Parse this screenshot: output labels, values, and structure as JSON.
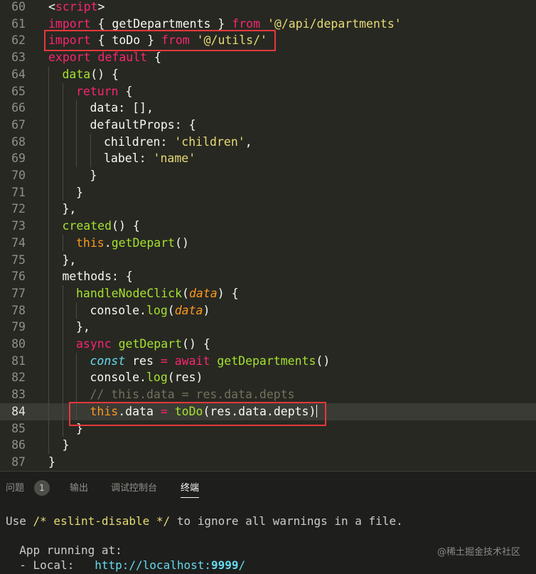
{
  "editor": {
    "lines": [
      {
        "num": "60",
        "indent": 0,
        "tokens": [
          {
            "c": "t-plain",
            "t": "<"
          },
          {
            "c": "t-tag",
            "t": "script"
          },
          {
            "c": "t-plain",
            "t": ">"
          }
        ]
      },
      {
        "num": "61",
        "indent": 0,
        "tokens": [
          {
            "c": "t-key",
            "t": "import"
          },
          {
            "c": "t-plain",
            "t": " { getDepartments } "
          },
          {
            "c": "t-key",
            "t": "from"
          },
          {
            "c": "t-plain",
            "t": " "
          },
          {
            "c": "t-str",
            "t": "'@/api/departments'"
          }
        ]
      },
      {
        "num": "62",
        "indent": 0,
        "tokens": [
          {
            "c": "t-key",
            "t": "import"
          },
          {
            "c": "t-plain",
            "t": " { toDo } "
          },
          {
            "c": "t-key",
            "t": "from"
          },
          {
            "c": "t-plain",
            "t": " "
          },
          {
            "c": "t-str",
            "t": "'@/utils/'"
          }
        ]
      },
      {
        "num": "63",
        "indent": 0,
        "tokens": [
          {
            "c": "t-key",
            "t": "export"
          },
          {
            "c": "t-plain",
            "t": " "
          },
          {
            "c": "t-key",
            "t": "default"
          },
          {
            "c": "t-plain",
            "t": " {"
          }
        ]
      },
      {
        "num": "64",
        "indent": 1,
        "tokens": [
          {
            "c": "t-fn",
            "t": "data"
          },
          {
            "c": "t-plain",
            "t": "() {"
          }
        ]
      },
      {
        "num": "65",
        "indent": 2,
        "tokens": [
          {
            "c": "t-key",
            "t": "return"
          },
          {
            "c": "t-plain",
            "t": " {"
          }
        ]
      },
      {
        "num": "66",
        "indent": 3,
        "tokens": [
          {
            "c": "t-plain",
            "t": "data: [],"
          }
        ]
      },
      {
        "num": "67",
        "indent": 3,
        "tokens": [
          {
            "c": "t-plain",
            "t": "defaultProps: {"
          }
        ]
      },
      {
        "num": "68",
        "indent": 4,
        "tokens": [
          {
            "c": "t-plain",
            "t": "children: "
          },
          {
            "c": "t-str",
            "t": "'children'"
          },
          {
            "c": "t-plain",
            "t": ","
          }
        ]
      },
      {
        "num": "69",
        "indent": 4,
        "tokens": [
          {
            "c": "t-plain",
            "t": "label: "
          },
          {
            "c": "t-str",
            "t": "'name'"
          }
        ]
      },
      {
        "num": "70",
        "indent": 3,
        "tokens": [
          {
            "c": "t-plain",
            "t": "}"
          }
        ]
      },
      {
        "num": "71",
        "indent": 2,
        "tokens": [
          {
            "c": "t-plain",
            "t": "}"
          }
        ]
      },
      {
        "num": "72",
        "indent": 1,
        "tokens": [
          {
            "c": "t-plain",
            "t": "},"
          }
        ]
      },
      {
        "num": "73",
        "indent": 1,
        "tokens": [
          {
            "c": "t-fn",
            "t": "created"
          },
          {
            "c": "t-plain",
            "t": "() {"
          }
        ]
      },
      {
        "num": "74",
        "indent": 2,
        "tokens": [
          {
            "c": "t-this",
            "t": "this"
          },
          {
            "c": "t-plain",
            "t": "."
          },
          {
            "c": "t-fn",
            "t": "getDepart"
          },
          {
            "c": "t-plain",
            "t": "()"
          }
        ]
      },
      {
        "num": "75",
        "indent": 1,
        "tokens": [
          {
            "c": "t-plain",
            "t": "},"
          }
        ]
      },
      {
        "num": "76",
        "indent": 1,
        "tokens": [
          {
            "c": "t-plain",
            "t": "methods: {"
          }
        ]
      },
      {
        "num": "77",
        "indent": 2,
        "tokens": [
          {
            "c": "t-fn",
            "t": "handleNodeClick"
          },
          {
            "c": "t-plain",
            "t": "("
          },
          {
            "c": "t-param",
            "t": "data"
          },
          {
            "c": "t-plain",
            "t": ") {"
          }
        ]
      },
      {
        "num": "78",
        "indent": 3,
        "tokens": [
          {
            "c": "t-plain",
            "t": "console."
          },
          {
            "c": "t-fn",
            "t": "log"
          },
          {
            "c": "t-plain",
            "t": "("
          },
          {
            "c": "t-param",
            "t": "data"
          },
          {
            "c": "t-plain",
            "t": ")"
          }
        ]
      },
      {
        "num": "79",
        "indent": 2,
        "tokens": [
          {
            "c": "t-plain",
            "t": "},"
          }
        ]
      },
      {
        "num": "80",
        "indent": 2,
        "tokens": [
          {
            "c": "t-key",
            "t": "async"
          },
          {
            "c": "t-plain",
            "t": " "
          },
          {
            "c": "t-fn",
            "t": "getDepart"
          },
          {
            "c": "t-plain",
            "t": "() {"
          }
        ]
      },
      {
        "num": "81",
        "indent": 3,
        "tokens": [
          {
            "c": "t-storage",
            "t": "const"
          },
          {
            "c": "t-plain",
            "t": " res "
          },
          {
            "c": "t-key",
            "t": "="
          },
          {
            "c": "t-plain",
            "t": " "
          },
          {
            "c": "t-key",
            "t": "await"
          },
          {
            "c": "t-plain",
            "t": " "
          },
          {
            "c": "t-fn",
            "t": "getDepartments"
          },
          {
            "c": "t-plain",
            "t": "()"
          }
        ]
      },
      {
        "num": "82",
        "indent": 3,
        "tokens": [
          {
            "c": "t-plain",
            "t": "console."
          },
          {
            "c": "t-fn",
            "t": "log"
          },
          {
            "c": "t-plain",
            "t": "(res)"
          }
        ]
      },
      {
        "num": "83",
        "indent": 3,
        "tokens": [
          {
            "c": "t-comment",
            "t": "// this.data = res.data.depts"
          }
        ]
      },
      {
        "num": "84",
        "indent": 3,
        "active": true,
        "tokens": [
          {
            "c": "t-this",
            "t": "this"
          },
          {
            "c": "t-plain",
            "t": ".data "
          },
          {
            "c": "t-key",
            "t": "="
          },
          {
            "c": "t-plain",
            "t": " "
          },
          {
            "c": "t-fn",
            "t": "toDo"
          },
          {
            "c": "t-plain",
            "t": "(res.data.depts)"
          }
        ]
      },
      {
        "num": "85",
        "indent": 2,
        "tokens": [
          {
            "c": "t-plain",
            "t": "}"
          }
        ]
      },
      {
        "num": "86",
        "indent": 1,
        "tokens": [
          {
            "c": "t-plain",
            "t": "}"
          }
        ]
      },
      {
        "num": "87",
        "indent": 0,
        "tokens": [
          {
            "c": "t-plain",
            "t": "}"
          }
        ]
      }
    ]
  },
  "panel": {
    "tabs": [
      {
        "label": "问题",
        "active": false
      },
      {
        "label": "输出",
        "active": false
      },
      {
        "label": "调试控制台",
        "active": false
      },
      {
        "label": "终端",
        "active": true
      }
    ],
    "problems_count": "1",
    "terminal": {
      "line1_prefix": "Use ",
      "line1_comment": "/* eslint-disable */",
      "line1_suffix": " to ignore all warnings in a file.",
      "line2": "  App running at:",
      "line3_label": "  - Local:   ",
      "line3_url": "http://localhost:",
      "line3_port": "9999",
      "line3_slash": "/"
    },
    "watermark": "@稀土掘金技术社区"
  },
  "colors": {
    "editor_bg": "#272822",
    "keyword": "#f92672",
    "function": "#a6e22e",
    "string": "#e6db74",
    "highlight_box": "#e5383b"
  }
}
